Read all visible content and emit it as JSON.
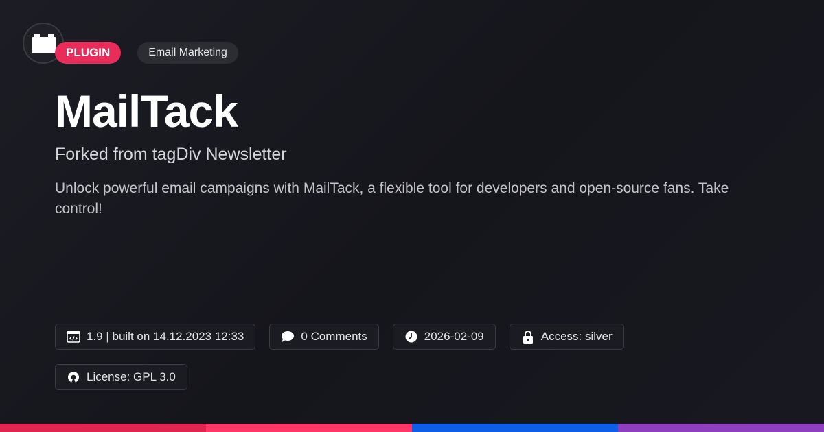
{
  "header": {
    "badge": "PLUGIN",
    "category": "Email Marketing"
  },
  "hero": {
    "title": "MailTack",
    "subtitle": "Forked from tagDiv Newsletter",
    "description": "Unlock powerful email campaigns with MailTack, a flexible tool for developers and open-source fans. Take control!"
  },
  "meta": {
    "version": "1.9 | built on 14.12.2023 12:33",
    "comments": "0 Comments",
    "date": "2026-02-09",
    "access": "Access: silver",
    "license": "License: GPL 3.0"
  },
  "icons": {
    "logo": "folder-icon",
    "version": "code-window-icon",
    "comments": "speech-bubble-icon",
    "date": "clock-icon",
    "access": "lock-icon",
    "license": "open-source-icon"
  },
  "colors": {
    "accent": "#e92c5a",
    "bar": [
      "#e02550",
      "#ff3768",
      "#0f5ee8",
      "#8e3fbf"
    ]
  }
}
